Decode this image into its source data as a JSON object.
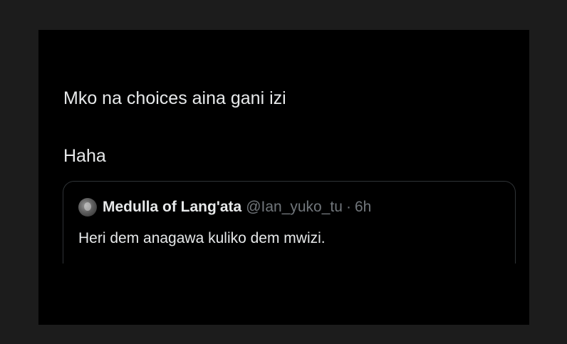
{
  "tweet": {
    "line1": "Mko na choices aina gani izi",
    "line2": "Haha"
  },
  "quoted_tweet": {
    "avatar_icon": "profile-avatar",
    "display_name": "Medulla of Lang'ata",
    "handle": "@Ian_yuko_tu",
    "separator": "·",
    "timestamp": "6h",
    "text": "Heri dem anagawa kuliko dem mwizi."
  },
  "colors": {
    "background": "#000000",
    "outer": "#1c1c1c",
    "text": "#e7e9ea",
    "muted": "#71767b",
    "border": "#2f3336"
  }
}
